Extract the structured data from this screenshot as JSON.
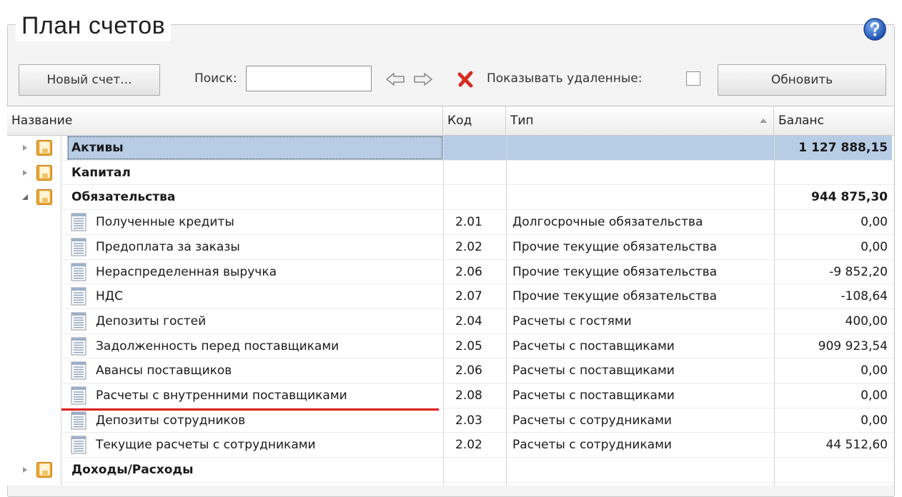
{
  "window": {
    "title": "План счетов"
  },
  "toolbar": {
    "new_account_label": "Новый счет...",
    "search_label": "Поиск:",
    "search_value": "",
    "search_placeholder": "",
    "show_deleted_label": "Показывать удаленные:",
    "show_deleted_checked": false,
    "refresh_label": "Обновить"
  },
  "icons": {
    "help": "help-icon",
    "back": "arrow-left-icon",
    "forward": "arrow-right-icon",
    "clear": "close-icon",
    "group": "folder-icon",
    "account": "document-icon",
    "sort": "sort-ascending-icon"
  },
  "colors": {
    "selection": "#b7cde6",
    "clear_icon": "#d62b20",
    "underline": "#e0201d",
    "help": "#2a63c4"
  },
  "table": {
    "columns": [
      {
        "label": "Название"
      },
      {
        "label": "Код"
      },
      {
        "label": "Тип",
        "sorted": "ascending"
      },
      {
        "label": "Баланс"
      }
    ],
    "rows": [
      {
        "kind": "group",
        "expanded": false,
        "selected": true,
        "name": "Активы",
        "code": "",
        "type": "",
        "balance": "1 127 888,15"
      },
      {
        "kind": "group",
        "expanded": false,
        "name": "Капитал",
        "code": "",
        "type": "",
        "balance": ""
      },
      {
        "kind": "group",
        "expanded": true,
        "name": "Обязательства",
        "code": "",
        "type": "",
        "balance": "944 875,30"
      },
      {
        "kind": "account",
        "name": "Полученные кредиты",
        "code": "2.01",
        "type": "Долгосрочные обязательства",
        "balance": "0,00"
      },
      {
        "kind": "account",
        "name": "Предоплата за заказы",
        "code": "2.02",
        "type": "Прочие текущие обязательства",
        "balance": "0,00"
      },
      {
        "kind": "account",
        "name": "Нераспределенная выручка",
        "code": "2.06",
        "type": "Прочие текущие обязательства",
        "balance": "-9 852,20"
      },
      {
        "kind": "account",
        "name": "НДС",
        "code": "2.07",
        "type": "Прочие текущие обязательства",
        "balance": "-108,64"
      },
      {
        "kind": "account",
        "name": "Депозиты гостей",
        "code": "2.04",
        "type": "Расчеты с гостями",
        "balance": "400,00"
      },
      {
        "kind": "account",
        "name": "Задолженность перед поставщиками",
        "code": "2.05",
        "type": "Расчеты с поставщиками",
        "balance": "909 923,54"
      },
      {
        "kind": "account",
        "name": "Авансы поставщиков",
        "code": "2.06",
        "type": "Расчеты с поставщиками",
        "balance": "0,00"
      },
      {
        "kind": "account",
        "name": "Расчеты с внутренними поставщиками",
        "code": "2.08",
        "type": "Расчеты с поставщиками",
        "balance": "0,00",
        "highlighted": true
      },
      {
        "kind": "account",
        "name": "Депозиты сотрудников",
        "code": "2.03",
        "type": "Расчеты с сотрудниками",
        "balance": "0,00"
      },
      {
        "kind": "account",
        "name": "Текущие расчеты с сотрудниками",
        "code": "2.02",
        "type": "Расчеты с сотрудниками",
        "balance": "44 512,60"
      },
      {
        "kind": "group",
        "expanded": false,
        "name": "Доходы/Расходы",
        "code": "",
        "type": "",
        "balance": ""
      }
    ]
  }
}
